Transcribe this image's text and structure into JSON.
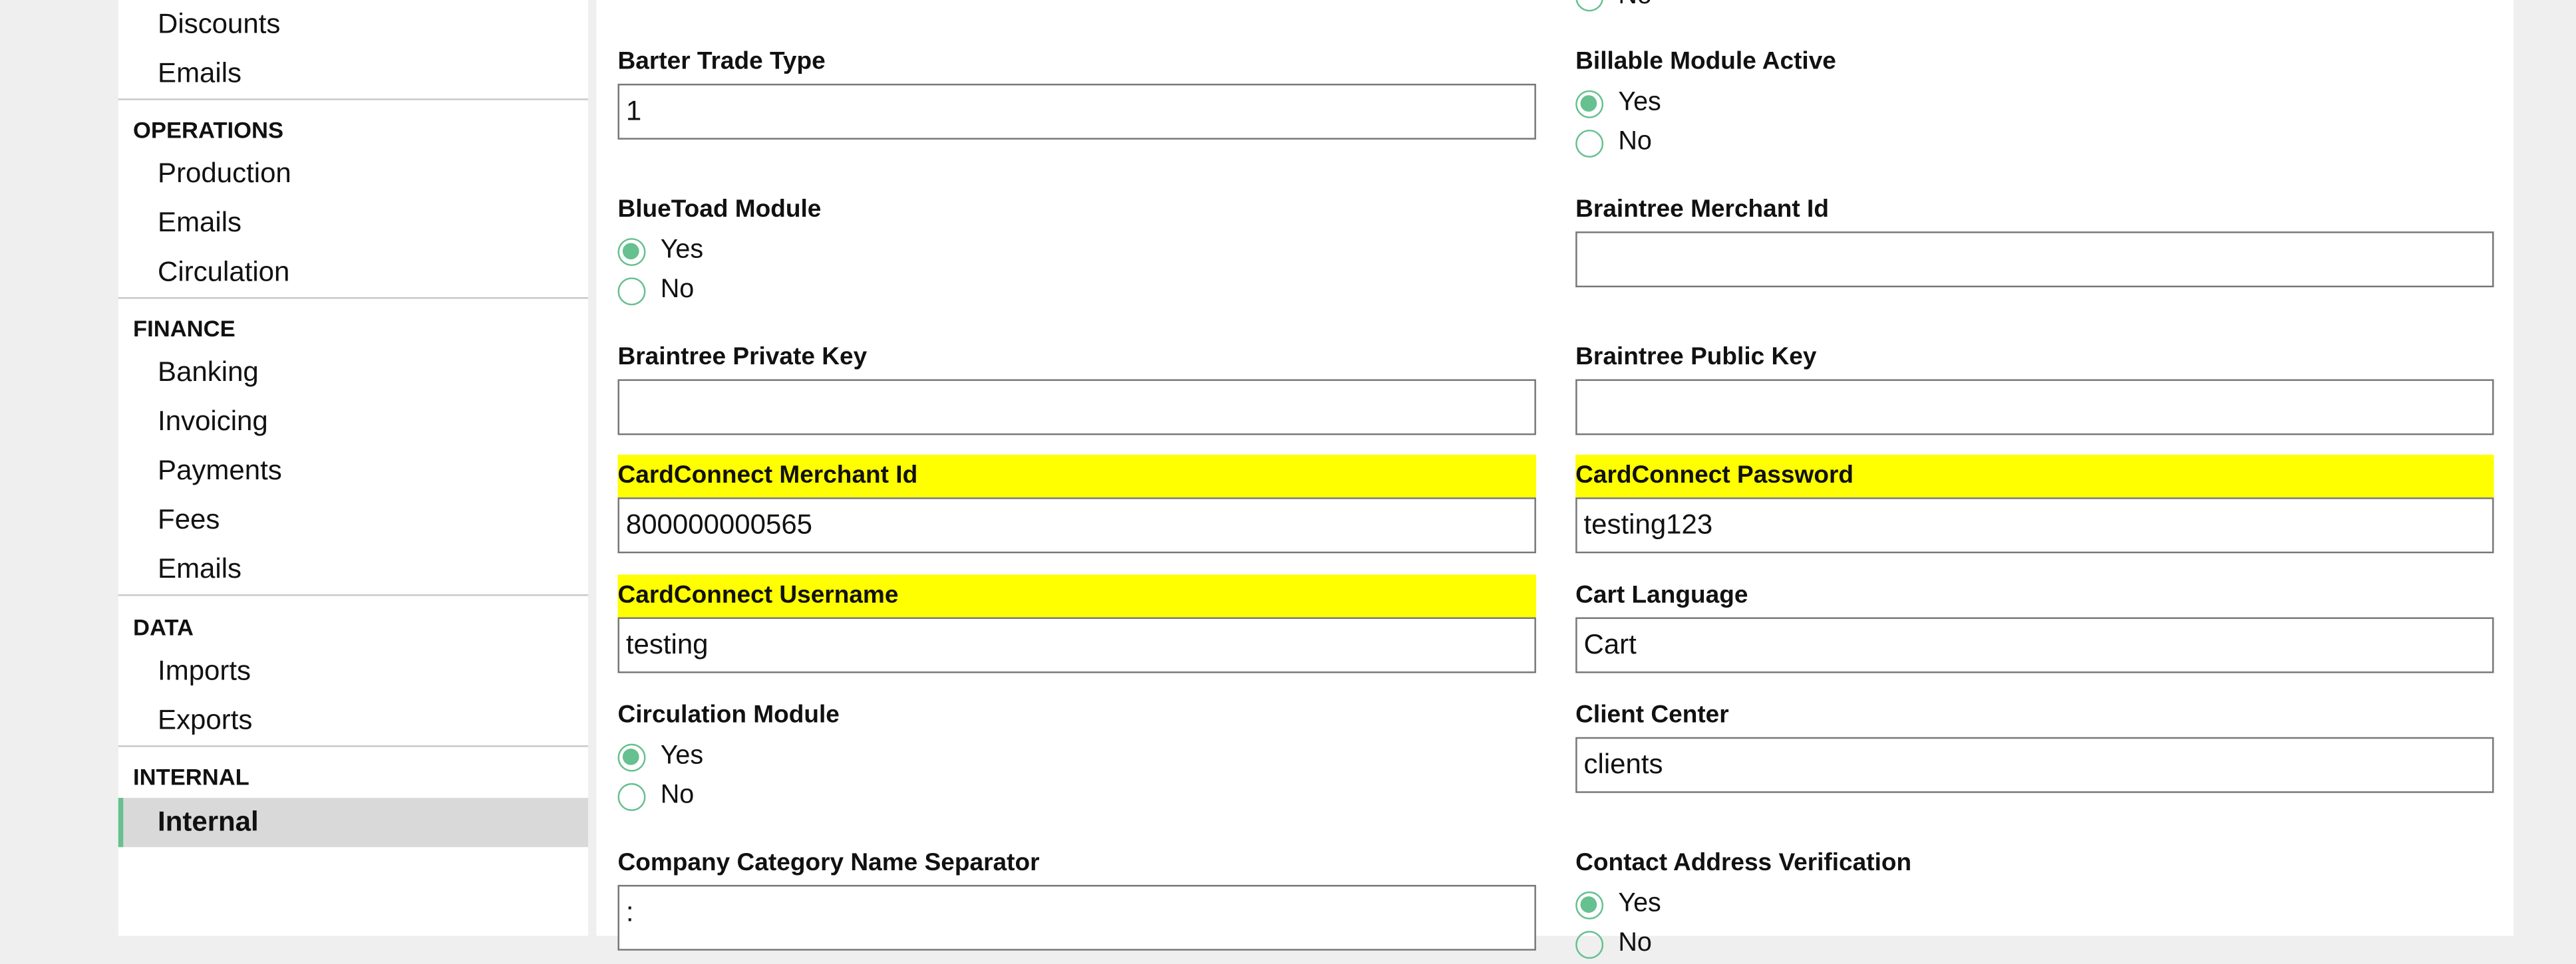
{
  "sidebar": {
    "items_top": [
      "Discounts",
      "Emails"
    ],
    "sections": [
      {
        "title": "OPERATIONS",
        "items": [
          "Production",
          "Emails",
          "Circulation"
        ]
      },
      {
        "title": "FINANCE",
        "items": [
          "Banking",
          "Invoicing",
          "Payments",
          "Fees",
          "Emails"
        ]
      },
      {
        "title": "DATA",
        "items": [
          "Imports",
          "Exports"
        ]
      },
      {
        "title": "INTERNAL",
        "items": [
          "Internal"
        ]
      }
    ],
    "active": "Internal"
  },
  "accent": "#66c08f",
  "highlight": "#ffff00",
  "radio": {
    "yes": "Yes",
    "no": "No"
  },
  "fields": {
    "barter_trade_type": {
      "label": "Barter Trade Type",
      "value": "1"
    },
    "billable_module_active": {
      "label": "Billable Module Active",
      "value": "Yes"
    },
    "bluetoad_module": {
      "label": "BlueToad Module",
      "value": "Yes"
    },
    "braintree_merchant_id": {
      "label": "Braintree Merchant Id",
      "value": ""
    },
    "braintree_private_key": {
      "label": "Braintree Private Key",
      "value": ""
    },
    "braintree_public_key": {
      "label": "Braintree Public Key",
      "value": ""
    },
    "cardconnect_merchant_id": {
      "label": "CardConnect Merchant Id",
      "value": "800000000565"
    },
    "cardconnect_password": {
      "label": "CardConnect Password",
      "value": "testing123"
    },
    "cardconnect_username": {
      "label": "CardConnect Username",
      "value": "testing"
    },
    "cart_language": {
      "label": "Cart Language",
      "value": "Cart"
    },
    "circulation_module": {
      "label": "Circulation Module",
      "value": "Yes"
    },
    "client_center": {
      "label": "Client Center",
      "value": "clients"
    },
    "company_category_name_separator": {
      "label": "Company Category Name Separator",
      "value": ":"
    },
    "contact_address_verification": {
      "label": "Contact Address Verification",
      "value": "Yes"
    }
  }
}
